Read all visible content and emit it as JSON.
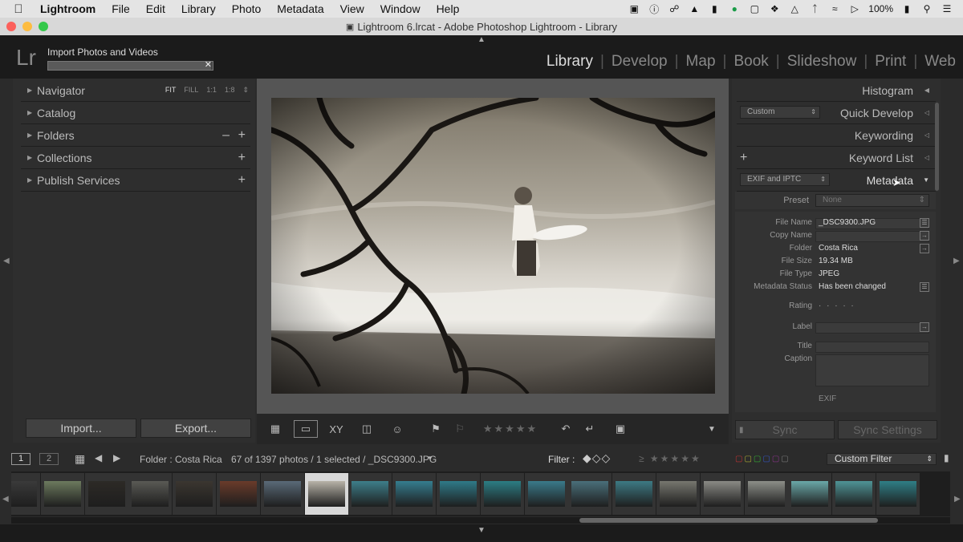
{
  "menubar": {
    "app_name": "Lightroom",
    "items": [
      "File",
      "Edit",
      "Library",
      "Photo",
      "Metadata",
      "View",
      "Window",
      "Help"
    ],
    "battery": "100%",
    "icons": [
      "camera-icon",
      "info-icon",
      "creative-cloud-icon",
      "drive-icon",
      "evernote-icon",
      "grammarly-icon",
      "cast-icon",
      "dropbox-icon",
      "airplay-icon",
      "bluetooth-icon",
      "wifi-icon",
      "volume-icon",
      "battery-icon",
      "search-icon",
      "list-icon"
    ]
  },
  "window": {
    "title": "Lightroom 6.lrcat - Adobe Photoshop Lightroom - Library",
    "traffic_lights": [
      "#fc605b",
      "#fdbc40",
      "#34c84a"
    ]
  },
  "topbar": {
    "logo": "Lr",
    "import_label": "Import Photos and Videos",
    "import_progress": 0.99,
    "modules": [
      "Library",
      "Develop",
      "Map",
      "Book",
      "Slideshow",
      "Print",
      "Web"
    ],
    "active_module": "Library"
  },
  "left_panel": {
    "navigator": {
      "label": "Navigator",
      "options": [
        "FIT",
        "FILL",
        "1:1",
        "1:8"
      ],
      "active": "FIT"
    },
    "catalog": {
      "label": "Catalog"
    },
    "folders": {
      "label": "Folders"
    },
    "collections": {
      "label": "Collections"
    },
    "publish": {
      "label": "Publish Services"
    },
    "import_button": "Import...",
    "export_button": "Export..."
  },
  "right_panel": {
    "histogram": "Histogram",
    "quick_develop": "Quick Develop",
    "quick_develop_preset": "Custom",
    "keywording": "Keywording",
    "keyword_list": "Keyword List",
    "metadata": "Metadata",
    "metadata_set": "EXIF and IPTC",
    "preset_label": "Preset",
    "preset_value": "None",
    "fields": [
      {
        "key": "File Name",
        "value": "_DSC9300.JPG"
      },
      {
        "key": "Copy Name",
        "value": ""
      },
      {
        "key": "Folder",
        "value": "Costa Rica"
      },
      {
        "key": "File Size",
        "value": "19.34 MB"
      },
      {
        "key": "File Type",
        "value": "JPEG"
      },
      {
        "key": "Metadata Status",
        "value": "Has been changed"
      }
    ],
    "rating_label": "Rating",
    "rating_value": "· · · · ·",
    "label_label": "Label",
    "title_label": "Title",
    "caption_label": "Caption",
    "exif_label": "EXIF",
    "sync_button": "Sync",
    "sync_settings_button": "Sync Settings"
  },
  "filterbar": {
    "page1": "1",
    "page2": "2",
    "source": "Folder : Costa Rica",
    "count": "67 of 1397 photos / 1 selected / _DSC9300.JPG",
    "filter_label": "Filter :",
    "filter_preset": "Custom Filter"
  },
  "filmstrip": {
    "selected_index": 7,
    "count": 21
  }
}
